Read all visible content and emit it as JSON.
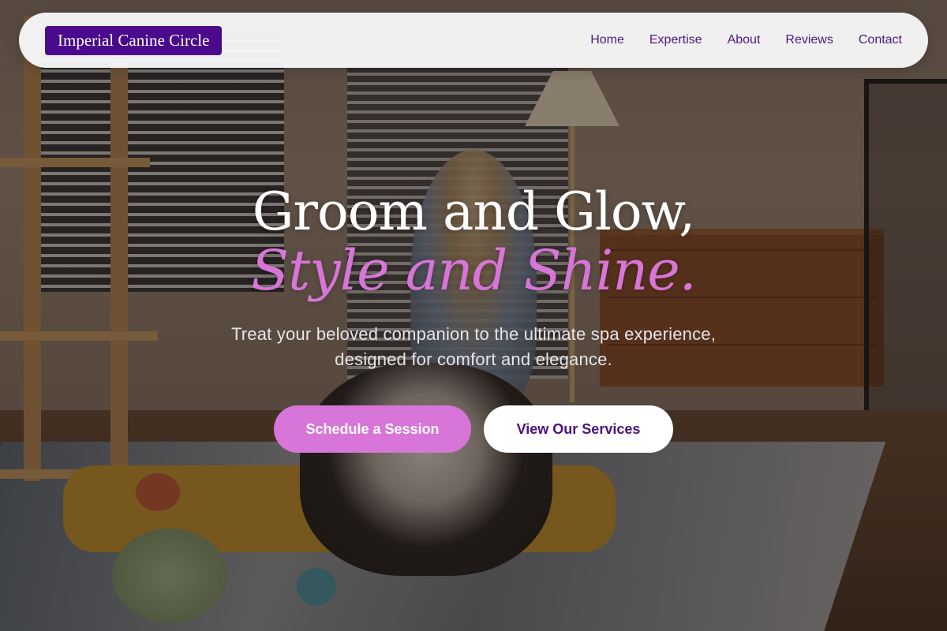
{
  "brand": {
    "name": "Imperial Canine Circle"
  },
  "nav": {
    "items": [
      {
        "label": "Home"
      },
      {
        "label": "Expertise"
      },
      {
        "label": "About"
      },
      {
        "label": "Reviews"
      },
      {
        "label": "Contact"
      }
    ]
  },
  "hero": {
    "title": "Groom and Glow,",
    "title_accent": "Style and Shine.",
    "subtitle": "Treat your beloved companion to the ultimate spa experience, designed for comfort and elegance.",
    "primary_cta": "Schedule a Session",
    "secondary_cta": "View Our Services"
  },
  "colors": {
    "brand_purple": "#4b0a8c",
    "accent_pink": "#d875d8",
    "header_bg": "#f8f7f8"
  },
  "background_image": {
    "semantic": "woman-petting-dog-in-living-room-photo"
  }
}
